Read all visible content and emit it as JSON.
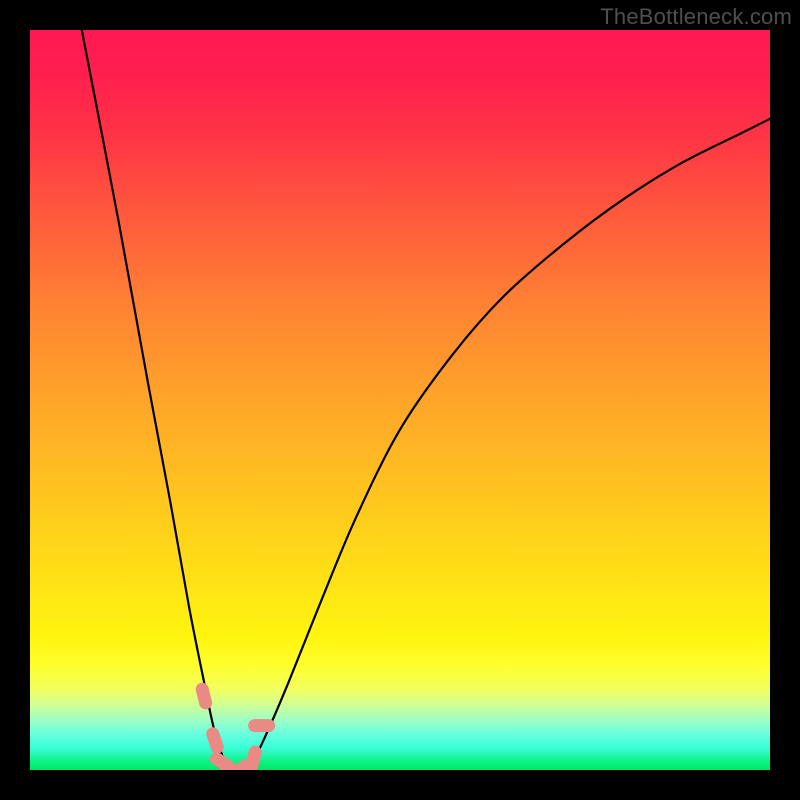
{
  "watermark": "TheBottleneck.com",
  "colors": {
    "frame": "#000000",
    "curve_stroke": "#000000",
    "marker_fill": "#e98b84",
    "marker_stroke": "#d36a63",
    "gradient_stops": [
      "#ff1852",
      "#ff1f4e",
      "#ff3345",
      "#ff5d3c",
      "#ff8432",
      "#ffa529",
      "#ffc31f",
      "#ffe116",
      "#fff50f",
      "#feff2e",
      "#f3ff5e",
      "#d4ff90",
      "#a4ffc0",
      "#6cffde",
      "#3affd8",
      "#0bf07f",
      "#00e864"
    ]
  },
  "chart_data": {
    "type": "line",
    "title": "",
    "xlabel": "",
    "ylabel": "",
    "xlim": [
      0,
      100
    ],
    "ylim": [
      0,
      100
    ],
    "note": "x and y are percentages of the plot area (origin at bottom-left). The curve is a V-shaped bottleneck profile. Values estimated from pixels.",
    "series": [
      {
        "name": "bottleneck-curve",
        "x": [
          7,
          12,
          16,
          19,
          21.5,
          23.5,
          25,
          26.5,
          28.5,
          30,
          32,
          35,
          39,
          44,
          50,
          57,
          64,
          72,
          80,
          88,
          96,
          100
        ],
        "y": [
          100,
          74,
          52,
          36,
          22,
          12,
          5,
          1,
          0,
          1,
          5,
          12,
          22,
          34,
          46,
          56,
          64,
          71,
          77,
          82,
          86,
          88
        ]
      }
    ],
    "markers": {
      "name": "highlighted-points",
      "x": [
        23.5,
        25,
        26,
        27.5,
        28.5,
        30.2,
        31.3
      ],
      "y": [
        10,
        4,
        1,
        0,
        0,
        1.5,
        6
      ]
    }
  }
}
